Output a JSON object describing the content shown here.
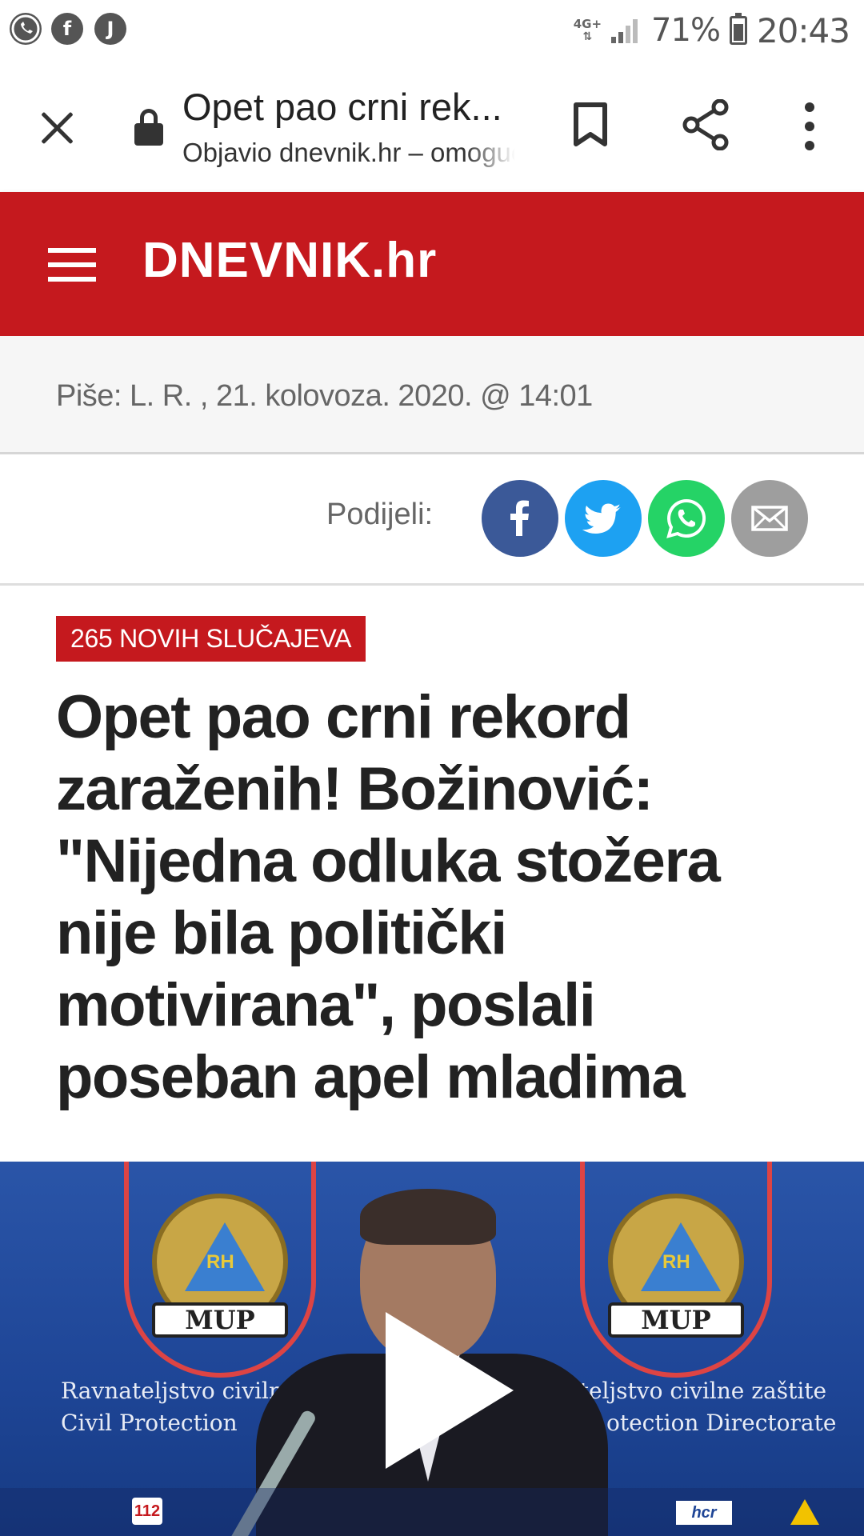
{
  "status_bar": {
    "notification_icons": [
      "whatsapp-icon",
      "facebook-icon",
      "j-app-icon"
    ],
    "notification_letters": {
      "facebook": "f",
      "j_app": "J"
    },
    "network": "4G+",
    "battery": "71%",
    "time": "20:43"
  },
  "toolbar": {
    "title": "Opet pao crni rek...",
    "subtitle": "Objavio dnevnik.hr – omogućio Google"
  },
  "site": {
    "logo": "DNEVNIK.hr",
    "brand_color": "#c5191e"
  },
  "article": {
    "byline": "Piše: L. R. , 21. kolovoza. 2020. @ 14:01",
    "share_label": "Podijeli:",
    "share_buttons": [
      {
        "name": "facebook",
        "color": "#3b5998"
      },
      {
        "name": "twitter",
        "color": "#1da1f2"
      },
      {
        "name": "whatsapp",
        "color": "#25d366"
      },
      {
        "name": "email",
        "color": "#9e9e9e"
      }
    ],
    "tag": "265 NOVIH SLUČAJEVA",
    "headline_lines": [
      "Opet pao crni rekord",
      "zaraženih! Božinović:",
      "\"Nijedna odluka stožera",
      "nije bila politički",
      "motivirana\", poslali",
      "poseban apel mladima"
    ]
  },
  "video": {
    "emblem_text": "MUP",
    "emblem_initials": "RH",
    "backdrop_line1_left": "Ravnateljstvo civilne",
    "backdrop_line2_left": "Civil Protection",
    "backdrop_line1_right": "nateljstvo civilne zaštite",
    "backdrop_line2_right": "otection Directorate",
    "badge_112": "112",
    "badge_hcr": "hcr"
  }
}
